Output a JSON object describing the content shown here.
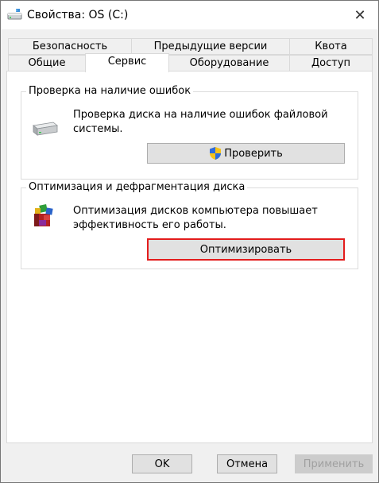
{
  "window": {
    "title": "Свойства: OS (C:)",
    "close_glyph": "✕"
  },
  "tabs": {
    "row_back": [
      "Безопасность",
      "Предыдущие версии",
      "Квота"
    ],
    "row_front": [
      "Общие",
      "Сервис",
      "Оборудование",
      "Доступ"
    ],
    "active": "Сервис"
  },
  "error_check": {
    "title": "Проверка на наличие ошибок",
    "description_line1": "Проверка диска на наличие ошибок файловой",
    "description_line2": "системы.",
    "button_label": "Проверить",
    "icon": "drive-icon"
  },
  "optimize": {
    "title": "Оптимизация и дефрагментация диска",
    "description_line1": "Оптимизация дисков компьютера повышает",
    "description_line2": "эффективность его работы.",
    "button_label": "Оптимизировать",
    "icon": "defrag-icon",
    "highlight_color": "#e31c1c"
  },
  "footer": {
    "ok_label": "OK",
    "cancel_label": "Отмена",
    "apply_label": "Применить"
  }
}
